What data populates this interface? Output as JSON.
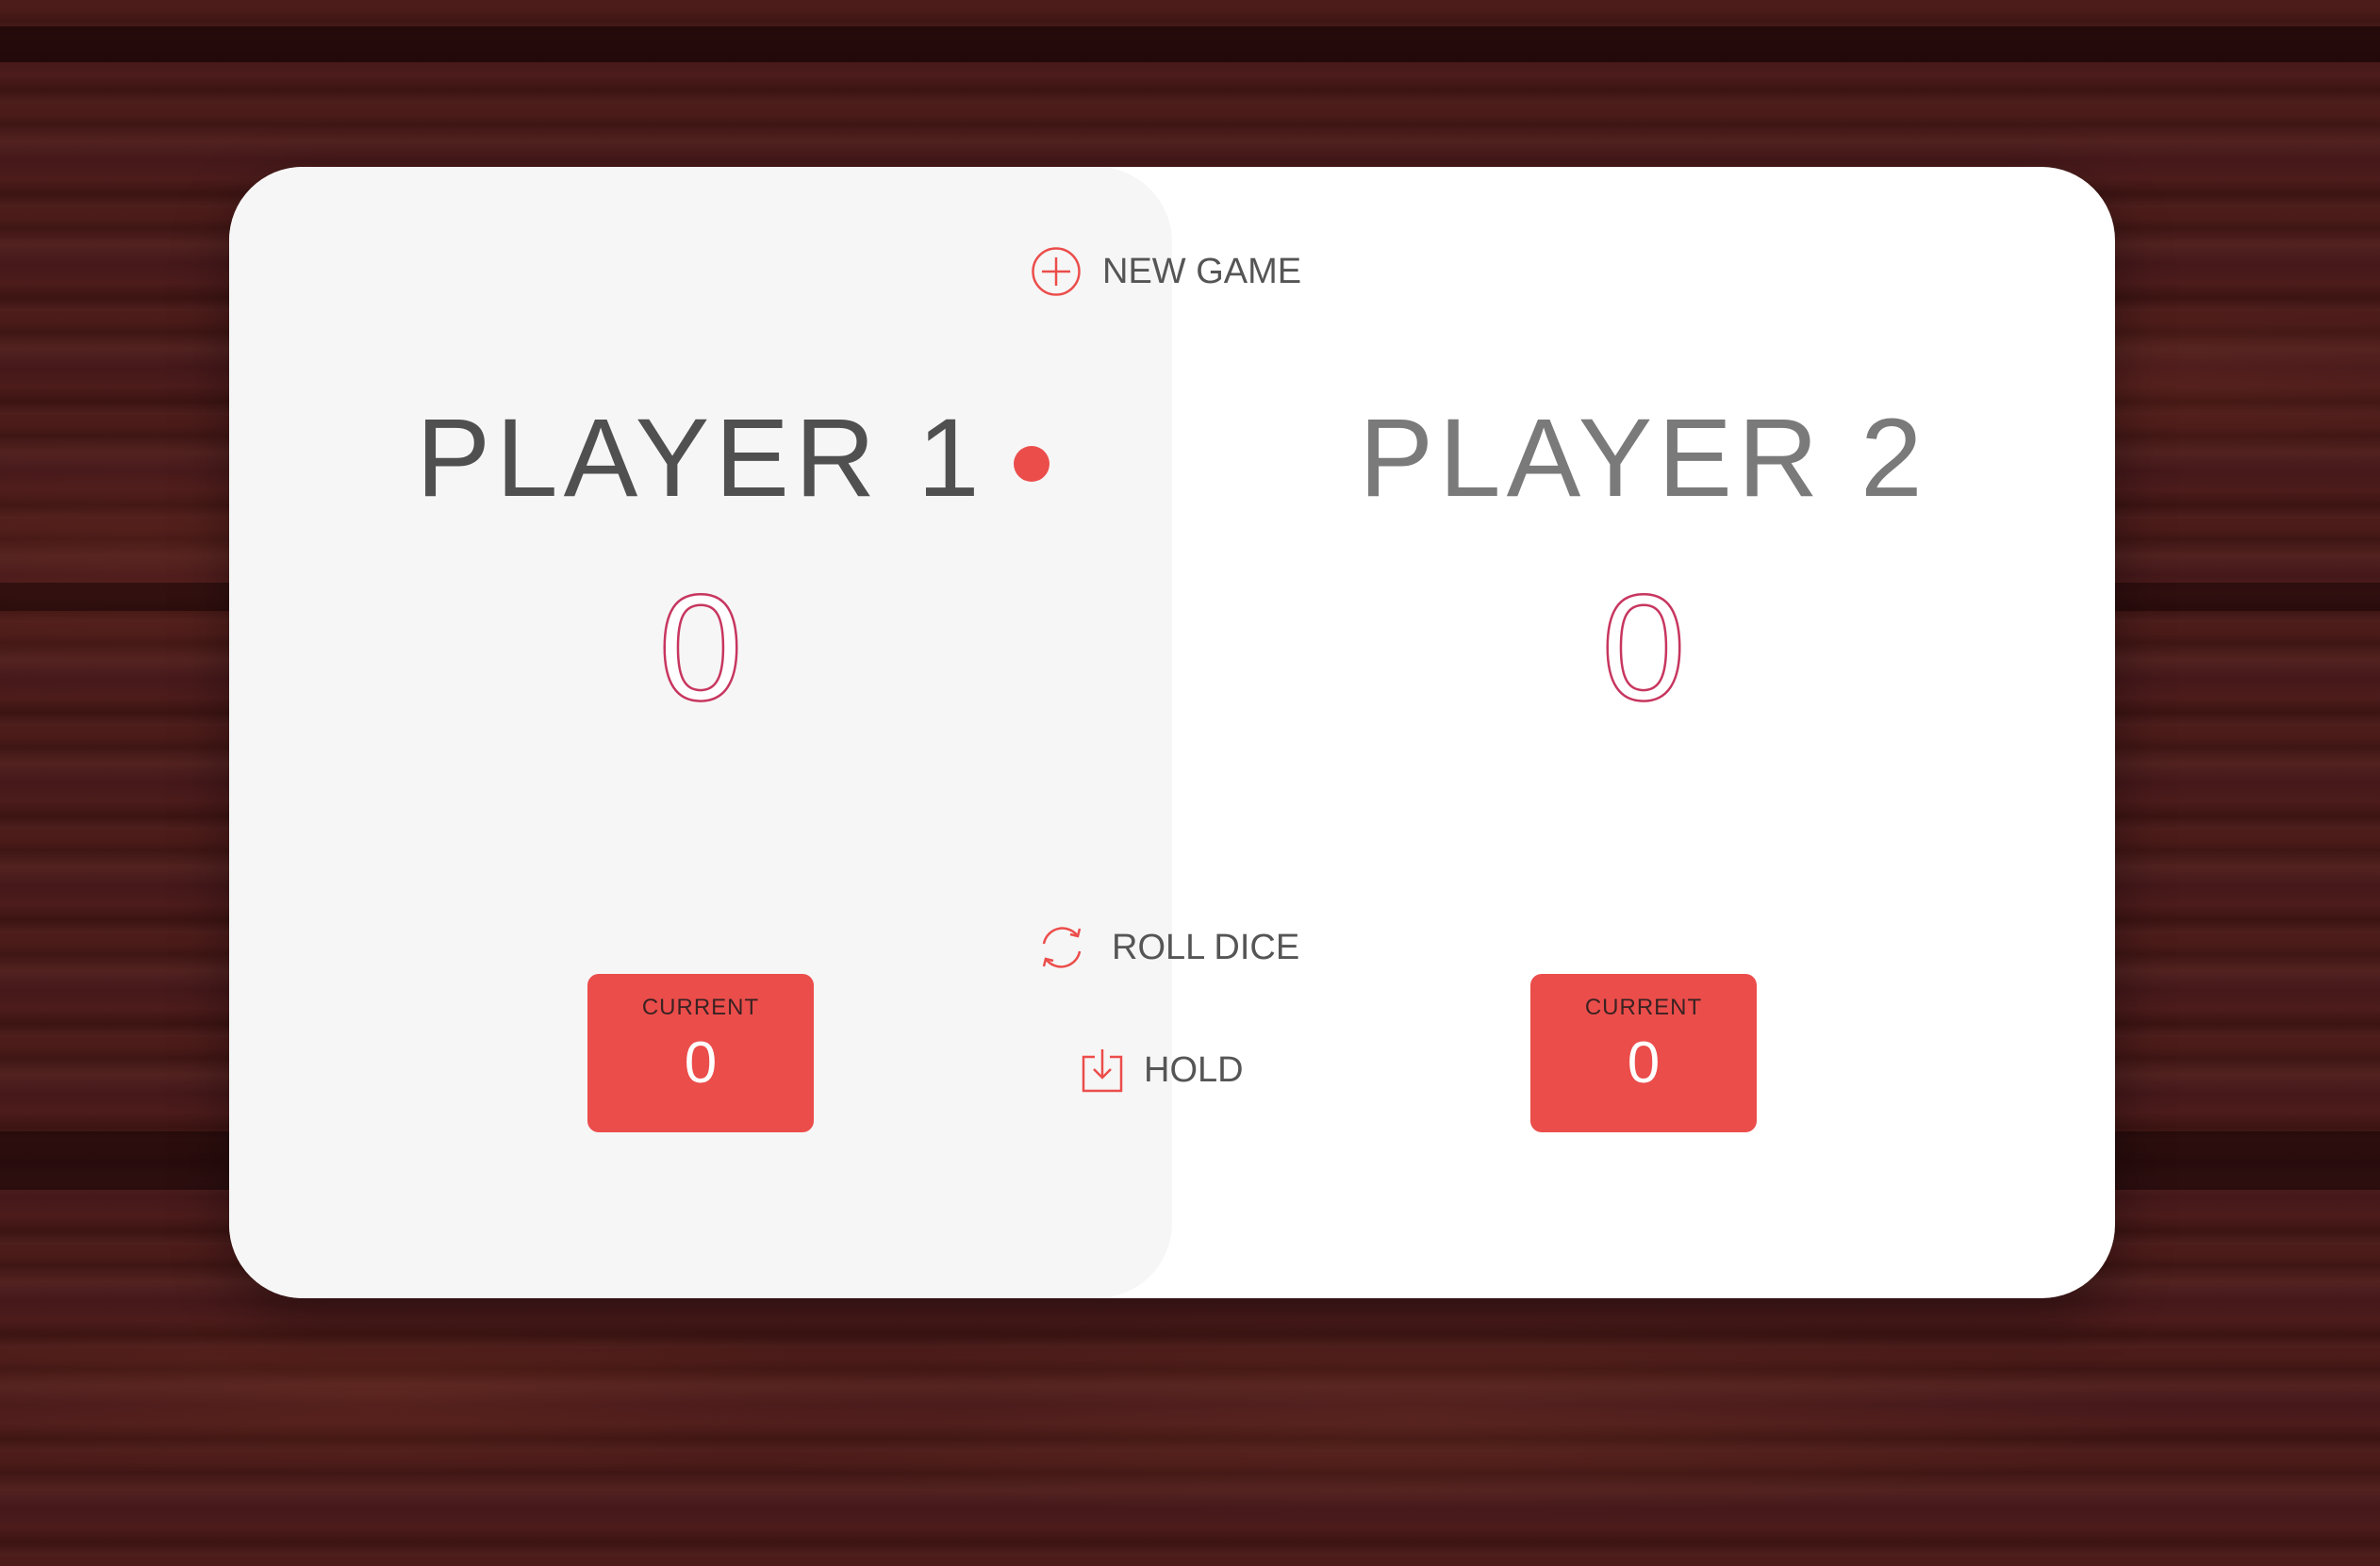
{
  "controls": {
    "new_game_label": "NEW GAME",
    "roll_dice_label": "ROLL DICE",
    "hold_label": "HOLD"
  },
  "players": [
    {
      "name": "PLAYER 1",
      "score": "0",
      "current_label": "CURRENT",
      "current_score": "0",
      "active": true
    },
    {
      "name": "PLAYER 2",
      "score": "0",
      "current_label": "CURRENT",
      "current_score": "0",
      "active": false
    }
  ],
  "colors": {
    "accent": "#eb4d4b",
    "score_outline": "#c7365f",
    "active_panel": "#f6f6f6",
    "inactive_panel": "#ffffff",
    "background": "#471a18"
  },
  "icons": {
    "new_game": "circle-plus-icon",
    "roll_dice": "refresh-icon",
    "hold": "download-box-icon"
  }
}
